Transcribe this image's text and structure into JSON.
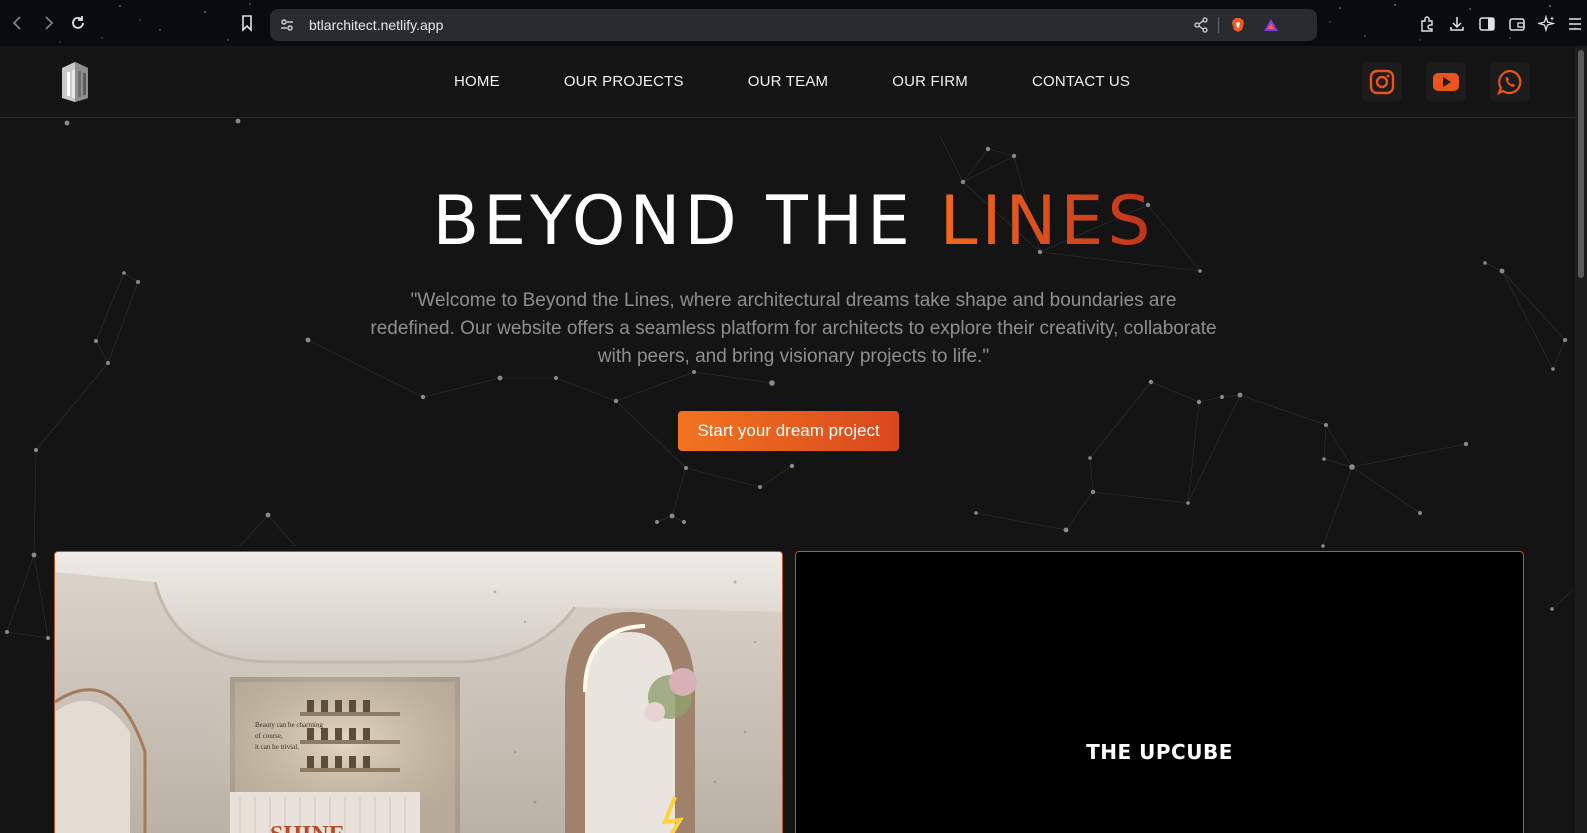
{
  "browser": {
    "url": "btlarchitect.netlify.app",
    "icons": [
      "back-icon",
      "forward-icon",
      "reload-icon",
      "bookmark-icon",
      "site-info-icon",
      "share-icon",
      "brave-shield-icon",
      "brave-rewards-icon",
      "extensions-icon",
      "download-icon",
      "sidebar-icon",
      "wallet-icon",
      "leo-ai-icon",
      "menu-icon"
    ]
  },
  "nav": {
    "items": [
      {
        "label": "HOME"
      },
      {
        "label": "OUR PROJECTS"
      },
      {
        "label": "OUR TEAM"
      },
      {
        "label": "OUR FIRM"
      },
      {
        "label": "CONTACT US"
      }
    ],
    "social": [
      "instagram-icon",
      "youtube-icon",
      "whatsapp-icon"
    ]
  },
  "hero": {
    "title_main": "BEYOND THE ",
    "title_accent": "LINES",
    "quote": "\"Welcome to Beyond the Lines, where architectural dreams take shape and boundaries are redefined. Our website offers a seamless platform for architects to explore their creativity, collaborate with peers, and bring visionary projects to life.\"",
    "cta": "Start your dream project"
  },
  "projects": {
    "left_signage": "SHINE",
    "left_wall_text": "Beauty can be charming of course, it can be trivial",
    "right_title": "THE UPCUBE"
  },
  "colors": {
    "accent": "#f26a1b",
    "accent_dark": "#c0321d",
    "background": "#141414",
    "border_accent": "#c0531f"
  }
}
